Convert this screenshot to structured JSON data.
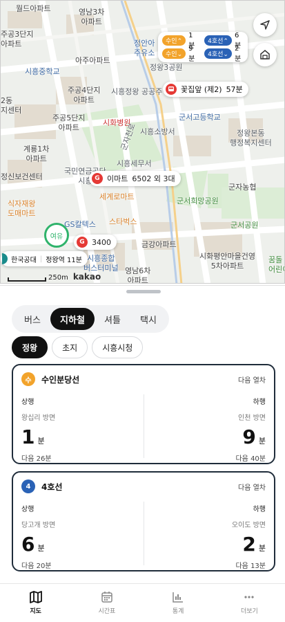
{
  "map": {
    "labels": {
      "worldu_apt": "월드아파트",
      "yeongnam3_apt": "영남3차\n아파트",
      "jugong3_apt": "주공3단지\n아파트",
      "ajuu_apt": "아주아파트",
      "siheung_school": "시흥중학교",
      "jugong4_apt": "주공4단지\n아파트",
      "siheung_complex": "시흥정왕 공공주택",
      "jugong2": "2동\n지센터",
      "jugong5_apt": "주공5단지\n아파트",
      "siwha_hospital": "시화병원",
      "gunseo_high": "군서고등학교",
      "siheung_fire": "시흥소방서",
      "jeongwang_welfare": "정왕본동\n행정복지센터",
      "gyerong_apt": "계룡1차\n아파트",
      "kukmin_apt": "국민연금공단\n시흥",
      "siheung_tax": "시흥세무서",
      "gunja_farm": "군자농협",
      "health_center": "정신보건센터",
      "local_mart": "식자재왕\n도매마트",
      "sekyero_mart": "세계로마트",
      "gunseo_park": "군서희망공원",
      "gunseo_park2": "군서공원",
      "starbucks": "스타벅스",
      "galtex": "GS칼텍스",
      "geumgang_apt": "금강아파트",
      "siwha_pyeongan": "시화평안마을건영\n5차아파트",
      "kkumdol": "꿈돌\n어린이",
      "siheung_terminal": "시흥종합\n버스터미널",
      "yeongnam6_apt": "영남6차\n아파트",
      "jeongwang3_office": "정왕3공원",
      "jeongwang_station_area": "정안아\n주유소",
      "gunjaro": "군자천로"
    },
    "arrival_card": {
      "rows": [
        {
          "line1": "수인",
          "time1": "1분",
          "line2": "4호선",
          "time2": "6분"
        },
        {
          "line1": "수인",
          "time1": "9분",
          "line2": "4호선",
          "time2": "2분"
        }
      ]
    },
    "bus_stop": {
      "name": "꽃집앞 (제2)",
      "time": "57분"
    },
    "emart": {
      "name": "이마트",
      "detail": "6502 외 3대"
    },
    "bus3400": {
      "name": "3400"
    },
    "yeoyu": "여유",
    "route_pin": {
      "a": "한국공대",
      "b": "정왕역 11분"
    },
    "scale": "250m",
    "brand": "kakao"
  },
  "tabs": {
    "items": [
      "버스",
      "지하철",
      "셔틀",
      "택시"
    ],
    "active": "지하철"
  },
  "stations": {
    "items": [
      "정왕",
      "초지",
      "시흥시청"
    ],
    "active": "정왕"
  },
  "cards": [
    {
      "badge": "수",
      "badge_color": "#f2a32b",
      "name": "수인분당선",
      "next_label": "다음 열차",
      "up": {
        "dir": "상행",
        "dest": "왕십리 방면",
        "min": "1",
        "unit": "분",
        "next": "다음 26분"
      },
      "down": {
        "dir": "하행",
        "dest": "인천 방면",
        "min": "9",
        "unit": "분",
        "next": "다음 40분"
      }
    },
    {
      "badge": "4",
      "badge_color": "#2a62b6",
      "name": "4호선",
      "next_label": "다음 열차",
      "up": {
        "dir": "상행",
        "dest": "당고개 방면",
        "min": "6",
        "unit": "분",
        "next": "다음 20분"
      },
      "down": {
        "dir": "하행",
        "dest": "오이도 방면",
        "min": "2",
        "unit": "분",
        "next": "다음 13분"
      }
    }
  ],
  "nav": {
    "items": [
      {
        "label": "지도",
        "icon": "map-icon"
      },
      {
        "label": "시간표",
        "icon": "calendar-icon"
      },
      {
        "label": "통계",
        "icon": "bar-chart-icon"
      },
      {
        "label": "더보기",
        "icon": "more-icon"
      }
    ],
    "active": "지도"
  },
  "colors": {
    "suin": "#f2a32b",
    "line4": "#2a62b6",
    "accent_dark": "#1f2c3a",
    "green": "#2fb36b",
    "red": "#e53935"
  }
}
